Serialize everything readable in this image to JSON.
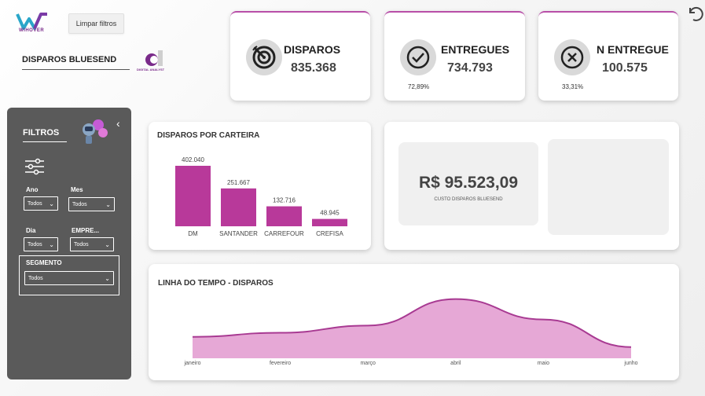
{
  "header": {
    "logo_text": "WIHOVER",
    "clear_filters_label": "Limpar filtros",
    "page_title": "DISPAROS BLUESEND",
    "partner_logo_text": "DIGITAL ANALYST"
  },
  "kpis": [
    {
      "label": "DISPAROS",
      "value": "835.368",
      "pct": "",
      "icon": "target-icon"
    },
    {
      "label": "ENTREGUES",
      "value": "734.793",
      "pct": "72,89%",
      "icon": "check-circle-icon"
    },
    {
      "label": "N ENTREGUE",
      "value": "100.575",
      "pct": "33,31%",
      "icon": "x-circle-icon"
    }
  ],
  "filters": {
    "title": "FILTROS",
    "ano": {
      "label": "Ano",
      "value": "Todos"
    },
    "mes": {
      "label": "Mes",
      "value": "Todos"
    },
    "dia": {
      "label": "Dia",
      "value": "Todos"
    },
    "empresa": {
      "label": "EMPRE...",
      "value": "Todos"
    },
    "segmento": {
      "label": "SEGMENTO",
      "value": "Todos"
    }
  },
  "colors": {
    "accent": "#b8399a",
    "area_fill": "#e6a8d6",
    "area_line": "#a83a92",
    "panel": "#5a5a5a"
  },
  "cost": {
    "value": "R$ 95.523,09",
    "label": "CUSTO DISPAROS BLUESEND"
  },
  "chart_data": [
    {
      "type": "bar",
      "title": "DISPAROS POR CARTEIRA",
      "categories": [
        "DM",
        "SANTANDER",
        "CARREFOUR",
        "CREFISA"
      ],
      "values": [
        402040,
        251667,
        132716,
        48945
      ],
      "value_labels": [
        "402.040",
        "251.667",
        "132.716",
        "48.945"
      ],
      "ylim": [
        0,
        402040
      ]
    },
    {
      "type": "area",
      "title": "LINHA DO TEMPO - DISPAROS",
      "categories": [
        "janeiro",
        "fevereiro",
        "março",
        "abril",
        "maio",
        "junho"
      ],
      "values": [
        105000,
        125000,
        160000,
        290000,
        190000,
        55000
      ],
      "ylim": [
        0,
        300000
      ]
    }
  ]
}
